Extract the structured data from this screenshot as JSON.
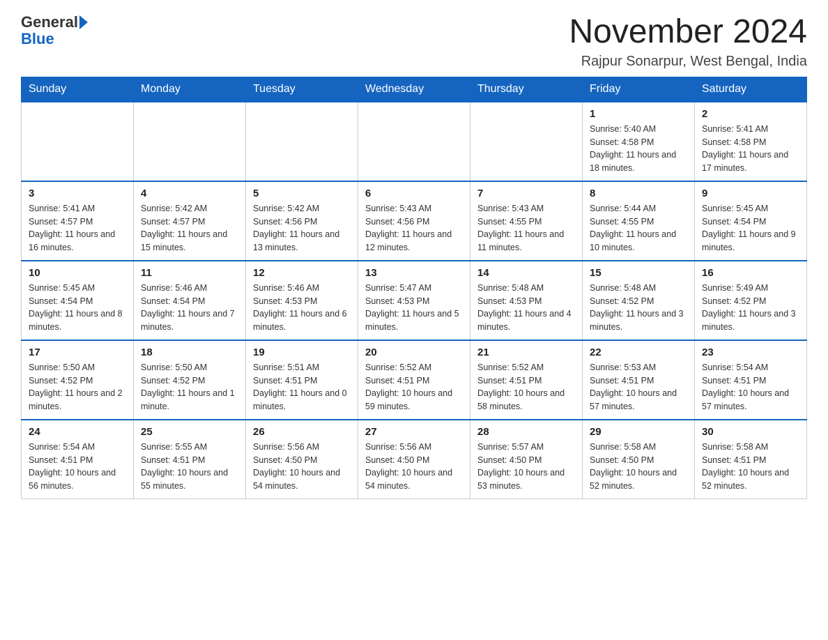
{
  "header": {
    "logo_general": "General",
    "logo_blue": "Blue",
    "title": "November 2024",
    "location": "Rajpur Sonarpur, West Bengal, India"
  },
  "days_of_week": [
    "Sunday",
    "Monday",
    "Tuesday",
    "Wednesday",
    "Thursday",
    "Friday",
    "Saturday"
  ],
  "weeks": [
    [
      {
        "day": "",
        "info": ""
      },
      {
        "day": "",
        "info": ""
      },
      {
        "day": "",
        "info": ""
      },
      {
        "day": "",
        "info": ""
      },
      {
        "day": "",
        "info": ""
      },
      {
        "day": "1",
        "info": "Sunrise: 5:40 AM\nSunset: 4:58 PM\nDaylight: 11 hours and 18 minutes."
      },
      {
        "day": "2",
        "info": "Sunrise: 5:41 AM\nSunset: 4:58 PM\nDaylight: 11 hours and 17 minutes."
      }
    ],
    [
      {
        "day": "3",
        "info": "Sunrise: 5:41 AM\nSunset: 4:57 PM\nDaylight: 11 hours and 16 minutes."
      },
      {
        "day": "4",
        "info": "Sunrise: 5:42 AM\nSunset: 4:57 PM\nDaylight: 11 hours and 15 minutes."
      },
      {
        "day": "5",
        "info": "Sunrise: 5:42 AM\nSunset: 4:56 PM\nDaylight: 11 hours and 13 minutes."
      },
      {
        "day": "6",
        "info": "Sunrise: 5:43 AM\nSunset: 4:56 PM\nDaylight: 11 hours and 12 minutes."
      },
      {
        "day": "7",
        "info": "Sunrise: 5:43 AM\nSunset: 4:55 PM\nDaylight: 11 hours and 11 minutes."
      },
      {
        "day": "8",
        "info": "Sunrise: 5:44 AM\nSunset: 4:55 PM\nDaylight: 11 hours and 10 minutes."
      },
      {
        "day": "9",
        "info": "Sunrise: 5:45 AM\nSunset: 4:54 PM\nDaylight: 11 hours and 9 minutes."
      }
    ],
    [
      {
        "day": "10",
        "info": "Sunrise: 5:45 AM\nSunset: 4:54 PM\nDaylight: 11 hours and 8 minutes."
      },
      {
        "day": "11",
        "info": "Sunrise: 5:46 AM\nSunset: 4:54 PM\nDaylight: 11 hours and 7 minutes."
      },
      {
        "day": "12",
        "info": "Sunrise: 5:46 AM\nSunset: 4:53 PM\nDaylight: 11 hours and 6 minutes."
      },
      {
        "day": "13",
        "info": "Sunrise: 5:47 AM\nSunset: 4:53 PM\nDaylight: 11 hours and 5 minutes."
      },
      {
        "day": "14",
        "info": "Sunrise: 5:48 AM\nSunset: 4:53 PM\nDaylight: 11 hours and 4 minutes."
      },
      {
        "day": "15",
        "info": "Sunrise: 5:48 AM\nSunset: 4:52 PM\nDaylight: 11 hours and 3 minutes."
      },
      {
        "day": "16",
        "info": "Sunrise: 5:49 AM\nSunset: 4:52 PM\nDaylight: 11 hours and 3 minutes."
      }
    ],
    [
      {
        "day": "17",
        "info": "Sunrise: 5:50 AM\nSunset: 4:52 PM\nDaylight: 11 hours and 2 minutes."
      },
      {
        "day": "18",
        "info": "Sunrise: 5:50 AM\nSunset: 4:52 PM\nDaylight: 11 hours and 1 minute."
      },
      {
        "day": "19",
        "info": "Sunrise: 5:51 AM\nSunset: 4:51 PM\nDaylight: 11 hours and 0 minutes."
      },
      {
        "day": "20",
        "info": "Sunrise: 5:52 AM\nSunset: 4:51 PM\nDaylight: 10 hours and 59 minutes."
      },
      {
        "day": "21",
        "info": "Sunrise: 5:52 AM\nSunset: 4:51 PM\nDaylight: 10 hours and 58 minutes."
      },
      {
        "day": "22",
        "info": "Sunrise: 5:53 AM\nSunset: 4:51 PM\nDaylight: 10 hours and 57 minutes."
      },
      {
        "day": "23",
        "info": "Sunrise: 5:54 AM\nSunset: 4:51 PM\nDaylight: 10 hours and 57 minutes."
      }
    ],
    [
      {
        "day": "24",
        "info": "Sunrise: 5:54 AM\nSunset: 4:51 PM\nDaylight: 10 hours and 56 minutes."
      },
      {
        "day": "25",
        "info": "Sunrise: 5:55 AM\nSunset: 4:51 PM\nDaylight: 10 hours and 55 minutes."
      },
      {
        "day": "26",
        "info": "Sunrise: 5:56 AM\nSunset: 4:50 PM\nDaylight: 10 hours and 54 minutes."
      },
      {
        "day": "27",
        "info": "Sunrise: 5:56 AM\nSunset: 4:50 PM\nDaylight: 10 hours and 54 minutes."
      },
      {
        "day": "28",
        "info": "Sunrise: 5:57 AM\nSunset: 4:50 PM\nDaylight: 10 hours and 53 minutes."
      },
      {
        "day": "29",
        "info": "Sunrise: 5:58 AM\nSunset: 4:50 PM\nDaylight: 10 hours and 52 minutes."
      },
      {
        "day": "30",
        "info": "Sunrise: 5:58 AM\nSunset: 4:51 PM\nDaylight: 10 hours and 52 minutes."
      }
    ]
  ]
}
